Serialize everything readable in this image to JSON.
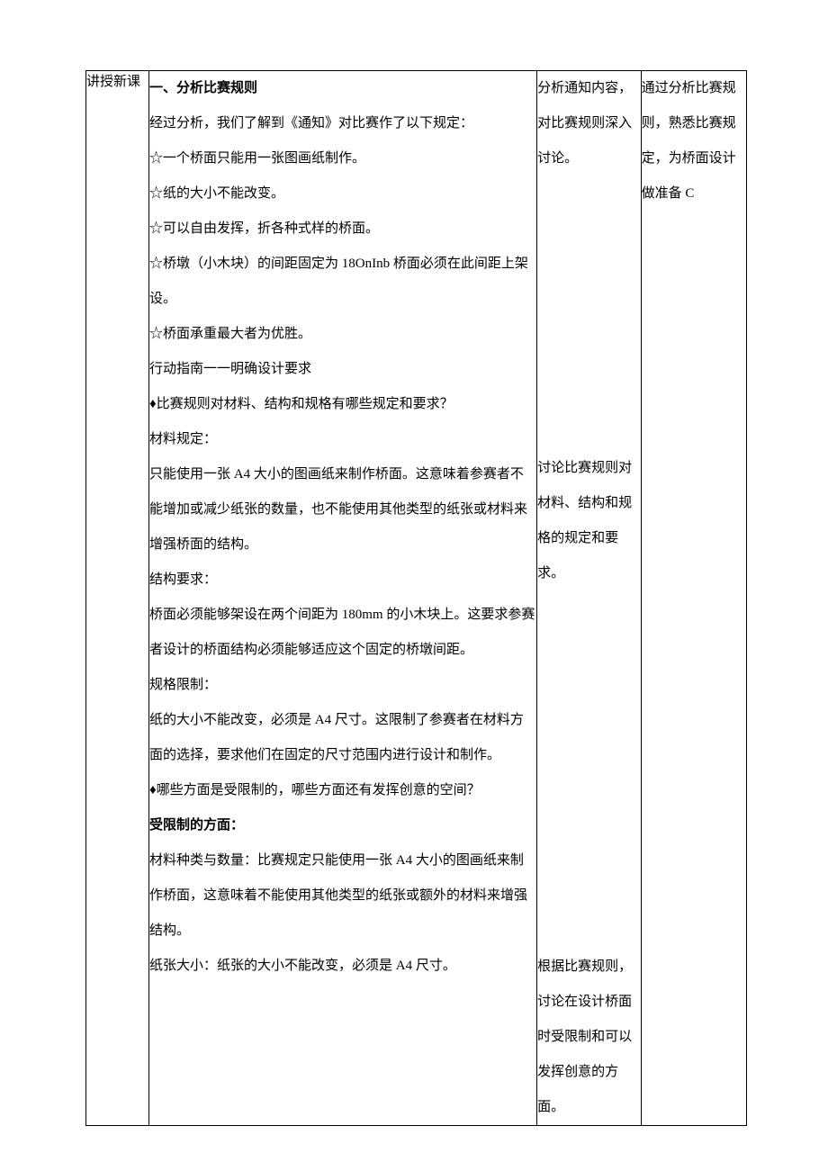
{
  "left": {
    "heading": "讲授新课"
  },
  "mid": {
    "h1": "一、分析比赛规则",
    "intro": "经过分析，我们了解到《通知》对比赛作了以下规定：",
    "star1": "一个桥面只能用一张图画纸制作。",
    "star2": "纸的大小不能改变。",
    "star3": "可以自由发挥，折各种式样的桥面。",
    "star4": "桥墩（小木块）的间距固定为 18OnInb 桥面必须在此间距上架设。",
    "star5": "桥面承重最大者为优胜。",
    "guide": "行动指南一一明确设计要求",
    "diam1": "比赛规则对材料、结构和规格有哪些规定和要求？",
    "mat_h": "材料规定：",
    "mat_b": "只能使用一张 A4 大小的图画纸来制作桥面。这意味着参赛者不能增加或减少纸张的数量，也不能使用其他类型的纸张或材料来增强桥面的结构。",
    "str_h": "结构要求：",
    "str_b": "桥面必须能够架设在两个间距为 180mm 的小木块上。这要求参赛者设计的桥面结构必须能够适应这个固定的桥墩间距。",
    "spec_h": "规格限制：",
    "spec_b": "纸的大小不能改变，必须是 A4 尺寸。这限制了参赛者在材料方面的选择，要求他们在固定的尺寸范围内进行设计和制作。",
    "diam2": "哪些方面是受限制的，哪些方面还有发挥创意的空间？",
    "limit_h": "受限制的方面：",
    "limit_b1": "材料种类与数量：比赛规定只能使用一张 A4 大小的图画纸来制作桥面，这意味着不能使用其他类型的纸张或额外的材料来增强结构。",
    "limit_b2": "纸张大小：纸张的大小不能改变，必须是 A4 尺寸。"
  },
  "r1": {
    "seg1": "分析通知内容，对比赛规则深入讨论。",
    "seg2": "讨论比赛规则对材料、结构和规格的规定和要求。",
    "seg3": "根据比赛规则，讨论在设计桥面时受限制和可以发挥创意的方面。"
  },
  "r2": {
    "seg1": "通过分析比赛规则，熟悉比赛规定，为桥面设计做准备 C"
  }
}
